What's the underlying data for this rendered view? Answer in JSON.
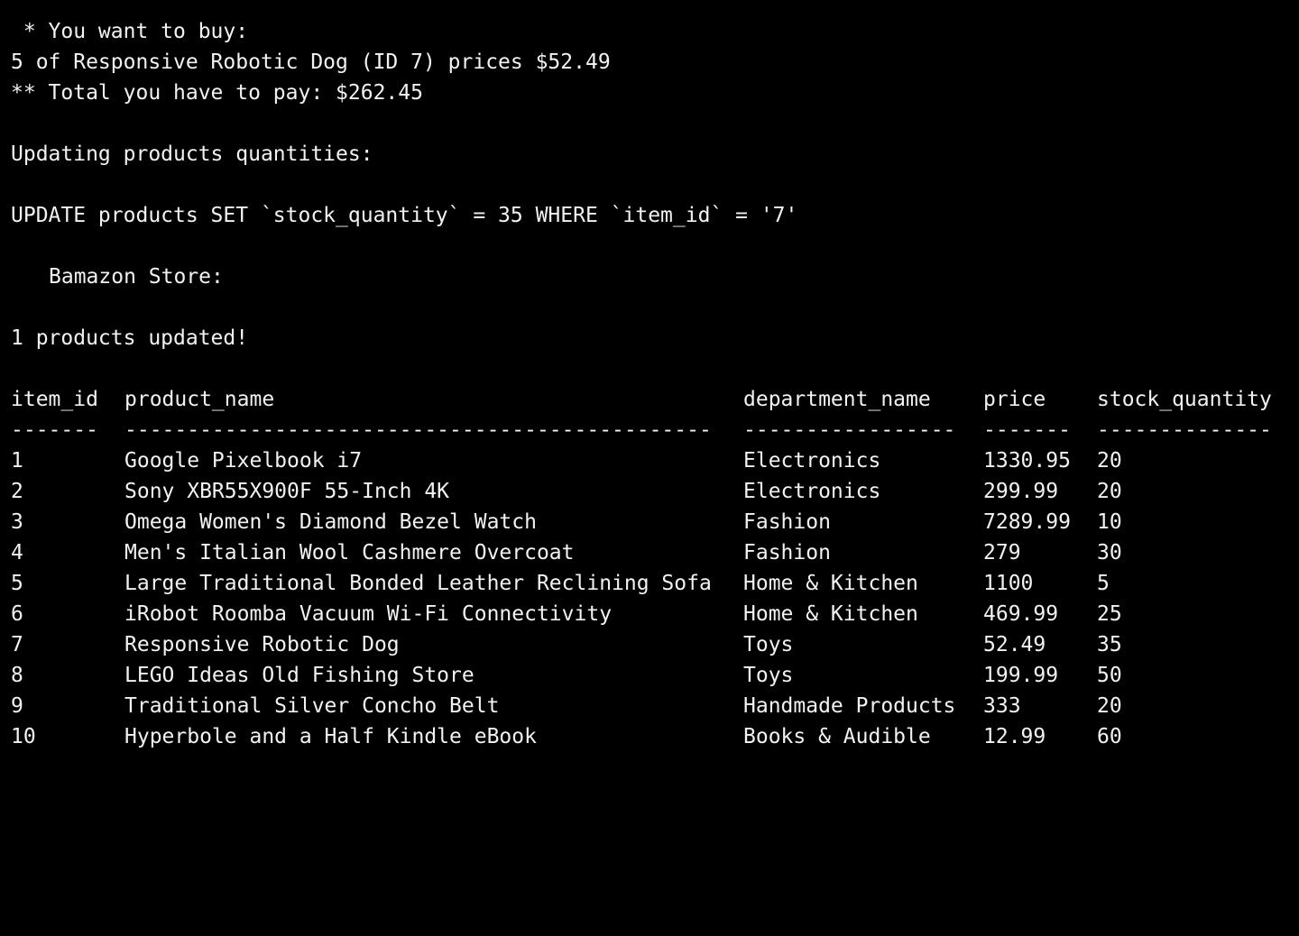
{
  "colors": {
    "background": "#000000",
    "text": "#f2f2f2"
  },
  "messages": {
    "want_to_buy": " * You want to buy:",
    "order_line": "5 of Responsive Robotic Dog (ID 7) prices $52.49",
    "total_line": "** Total you have to pay: $262.45",
    "updating": "Updating products quantities:",
    "sql": "UPDATE products SET `stock_quantity` = 35 WHERE `item_id` = '7'",
    "store_title": "Bamazon Store:",
    "updated": "1 products updated!"
  },
  "table": {
    "headers": {
      "item_id": "item_id",
      "product_name": "product_name",
      "department_name": "department_name",
      "price": "price",
      "stock_quantity": "stock_quantity"
    },
    "separators": {
      "item_id": "-------",
      "product_name": "-----------------------------------------------",
      "department_name": "-----------------",
      "price": "-------",
      "stock_quantity": "--------------"
    },
    "rows": [
      {
        "item_id": "1",
        "product_name": "Google Pixelbook i7",
        "department_name": "Electronics",
        "price": "1330.95",
        "stock_quantity": "20"
      },
      {
        "item_id": "2",
        "product_name": "Sony XBR55X900F 55-Inch 4K",
        "department_name": "Electronics",
        "price": "299.99",
        "stock_quantity": "20"
      },
      {
        "item_id": "3",
        "product_name": "Omega Women's Diamond Bezel Watch",
        "department_name": "Fashion",
        "price": "7289.99",
        "stock_quantity": "10"
      },
      {
        "item_id": "4",
        "product_name": "Men's Italian Wool Cashmere Overcoat",
        "department_name": "Fashion",
        "price": "279",
        "stock_quantity": "30"
      },
      {
        "item_id": "5",
        "product_name": "Large Traditional Bonded Leather Reclining Sofa",
        "department_name": "Home & Kitchen",
        "price": "1100",
        "stock_quantity": "5"
      },
      {
        "item_id": "6",
        "product_name": "iRobot Roomba Vacuum Wi-Fi Connectivity",
        "department_name": "Home & Kitchen",
        "price": "469.99",
        "stock_quantity": "25"
      },
      {
        "item_id": "7",
        "product_name": "Responsive Robotic Dog",
        "department_name": "Toys",
        "price": "52.49",
        "stock_quantity": "35"
      },
      {
        "item_id": "8",
        "product_name": "LEGO Ideas Old Fishing Store",
        "department_name": "Toys",
        "price": "199.99",
        "stock_quantity": "50"
      },
      {
        "item_id": "9",
        "product_name": "Traditional Silver Concho Belt",
        "department_name": "Handmade Products",
        "price": "333",
        "stock_quantity": "20"
      },
      {
        "item_id": "10",
        "product_name": "Hyperbole and a Half Kindle eBook",
        "department_name": "Books & Audible",
        "price": "12.99",
        "stock_quantity": "60"
      }
    ]
  }
}
